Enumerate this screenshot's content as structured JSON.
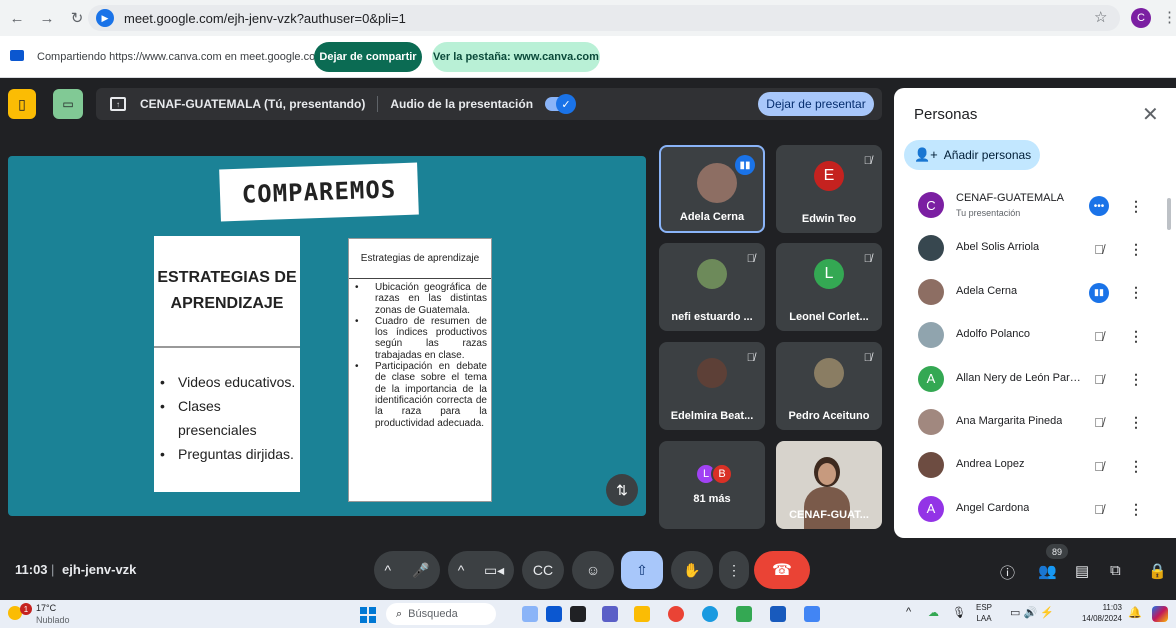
{
  "browser": {
    "url": "meet.google.com/ejh-jenv-vzk?authuser=0&pli=1",
    "profile_initial": "C"
  },
  "sharing_bar": {
    "text": "Compartiendo https://www.canva.com en meet.google.com",
    "stop_label": "Dejar de compartir",
    "view_tab_label": "Ver la pestaña: www.canva.com"
  },
  "presentation_bar": {
    "title": "CENAF-GUATEMALA (Tú, presentando)",
    "audio_label": "Audio de la presentación",
    "audio_enabled": true,
    "stop_label": "Dejar de presentar"
  },
  "slide": {
    "title": "COMPAREMOS",
    "left_card": {
      "heading_line1": "ESTRATEGIAS DE",
      "heading_line2": "APRENDIZAJE",
      "items": [
        "Videos educativos.",
        "Clases presenciales",
        "Preguntas dirjidas."
      ]
    },
    "right_card": {
      "heading": "Estrategias de aprendizaje",
      "items": [
        "Ubicación geográfica de razas en las distintas zonas de Guatemala.",
        "Cuadro de resumen de los índices productivos según las razas trabajadas en clase.",
        "Participación en debate de clase sobre el tema de la importancia de la identificación correcta de la raza para la productividad adecuada."
      ]
    }
  },
  "tiles": [
    {
      "name": "Adela Cerna",
      "speaking": true
    },
    {
      "name": "Edwin Teo",
      "initial": "E",
      "color": "#c5221f",
      "muted": true
    },
    {
      "name": "nefi estuardo ...",
      "muted": true
    },
    {
      "name": "Leonel Corlet...",
      "initial": "L",
      "color": "#34a853",
      "muted": true
    },
    {
      "name": "Edelmira Beat...",
      "muted": true
    },
    {
      "name": "Pedro Aceituno",
      "muted": true
    },
    {
      "name": "81 más",
      "avatars": [
        "L",
        "B"
      ],
      "avatar_colors": [
        "#a142f4",
        "#d93025"
      ]
    },
    {
      "name": "CENAF-GUAT..."
    }
  ],
  "people_panel": {
    "title": "Personas",
    "add_label": "Añadir personas",
    "people": [
      {
        "name": "CENAF-GUATEMALA",
        "sub": "Tu presentación",
        "initial": "C",
        "color": "#7b1fa2",
        "status": "more"
      },
      {
        "name": "Abel Solis Arriola",
        "color": "#37474f",
        "status": "muted"
      },
      {
        "name": "Adela Cerna",
        "color": "#8d6e63",
        "status": "speaking"
      },
      {
        "name": "Adolfo Polanco",
        "color": "#90a4ae",
        "status": "muted"
      },
      {
        "name": "Allan Nery de León Para...",
        "initial": "A",
        "color": "#34a853",
        "status": "muted"
      },
      {
        "name": "Ana Margarita Pineda",
        "color": "#a1887f",
        "status": "muted"
      },
      {
        "name": "Andrea Lopez",
        "color": "#6d4c41",
        "status": "muted"
      },
      {
        "name": "Angel Cardona",
        "initial": "A",
        "color": "#9334e6",
        "status": "muted"
      }
    ]
  },
  "bottom_bar": {
    "time": "11:03",
    "meeting_code": "ejh-jenv-vzk",
    "participant_count": "89"
  },
  "taskbar": {
    "weather_badge": "1",
    "temperature": "17°C",
    "weather": "Nublado",
    "search_placeholder": "Búsqueda",
    "lang_line1": "ESP",
    "lang_line2": "LAA",
    "clock_time": "11:03",
    "clock_date": "14/08/2024"
  }
}
